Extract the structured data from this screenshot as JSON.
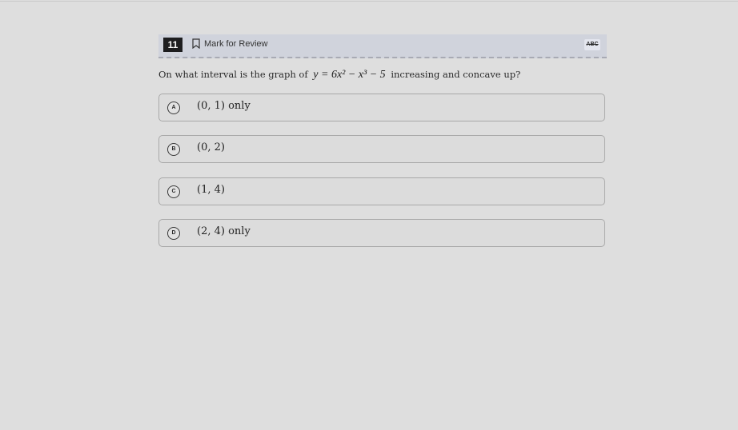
{
  "question": {
    "number": "11",
    "mark_for_review_label": "Mark for Review",
    "abc_label": "ABC",
    "prompt_prefix": "On what interval is the graph of",
    "equation": "y = 6x² − x³ − 5",
    "prompt_suffix": "increasing and concave up?"
  },
  "choices": [
    {
      "letter": "A",
      "text": "(0, 1) only"
    },
    {
      "letter": "B",
      "text": "(0, 2)"
    },
    {
      "letter": "C",
      "text": "(1, 4)"
    },
    {
      "letter": "D",
      "text": "(2, 4) only"
    }
  ],
  "icons": {
    "bookmark": "bookmark-icon",
    "abc": "strikethrough-abc-icon"
  }
}
